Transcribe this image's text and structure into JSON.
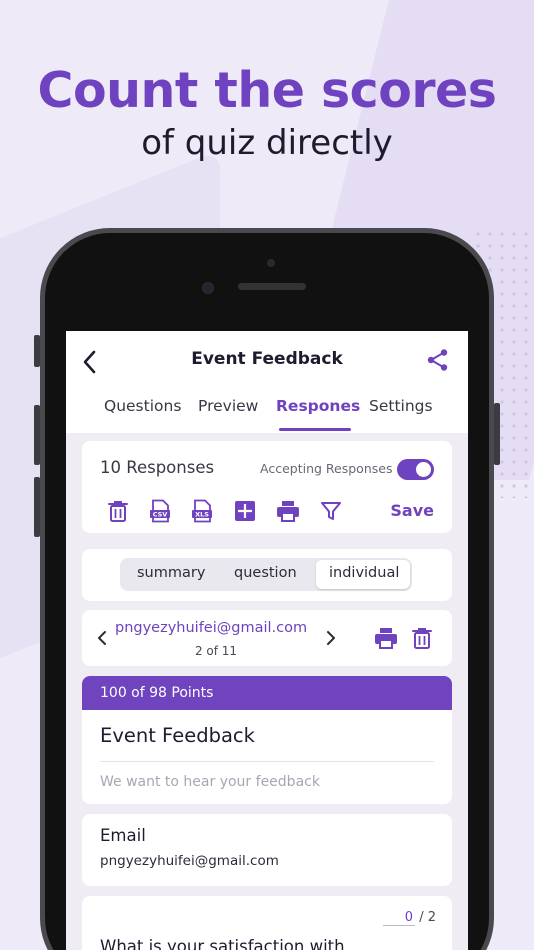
{
  "promo": {
    "headline": "Count the scores",
    "subline": "of quiz directly"
  },
  "header": {
    "title": "Event Feedback",
    "back_icon": "chevron-left-icon",
    "share_icon": "share-icon"
  },
  "tabs": [
    {
      "label": "Questions",
      "active": false
    },
    {
      "label": "Preview",
      "active": false
    },
    {
      "label": "Respones",
      "active": true
    },
    {
      "label": "Settings",
      "active": false
    }
  ],
  "responses": {
    "title": "10 Responses",
    "accepting_label": "Accepting Responses",
    "accepting": true,
    "save_label": "Save",
    "tools": [
      "trash-icon",
      "csv-icon",
      "xls-icon",
      "sheet-icon",
      "print-icon",
      "filter-icon"
    ],
    "csv_text": "CSV",
    "xls_text": "XLS"
  },
  "segments": {
    "items": [
      "summary",
      "question",
      "individual"
    ],
    "selected": "individual"
  },
  "navigator": {
    "email": "pngyezyhuifei@gmail.com",
    "count": "2 of 11"
  },
  "form": {
    "points": "100 of 98 Points",
    "title": "Event Feedback",
    "description": "We want to hear your feedback"
  },
  "email_field": {
    "label": "Email",
    "value": "pngyezyhuifei@gmail.com"
  },
  "question": {
    "earned": "0",
    "total": "/ 2",
    "text": "What is your satisfaction with"
  },
  "colors": {
    "accent": "#6f42bf",
    "background": "#efeaf8"
  }
}
